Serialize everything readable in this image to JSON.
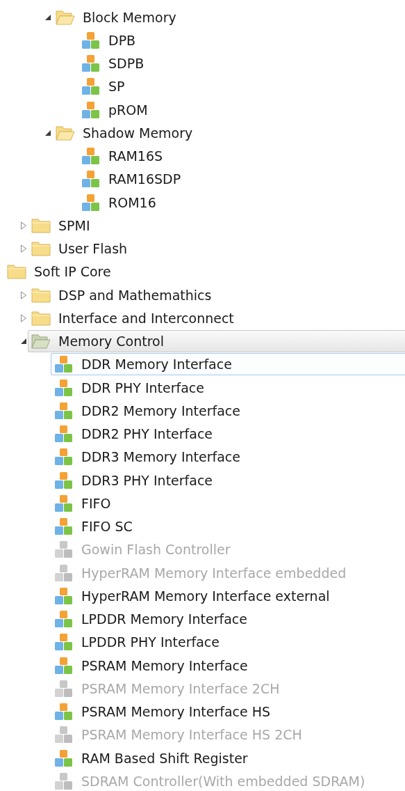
{
  "tree": [
    {
      "kind": "offscreen",
      "children": [
        {
          "kind": "offscreen",
          "children": [
            {
              "kind": "folder",
              "label": "Block Memory",
              "expanded": true,
              "selected": false,
              "children": [
                {
                  "kind": "ip",
                  "label": "DPB",
                  "disabled": false,
                  "selected": false
                },
                {
                  "kind": "ip",
                  "label": "SDPB",
                  "disabled": false,
                  "selected": false
                },
                {
                  "kind": "ip",
                  "label": "SP",
                  "disabled": false,
                  "selected": false
                },
                {
                  "kind": "ip",
                  "label": "pROM",
                  "disabled": false,
                  "selected": false
                }
              ]
            },
            {
              "kind": "folder",
              "label": "Shadow Memory",
              "expanded": true,
              "selected": false,
              "children": [
                {
                  "kind": "ip",
                  "label": "RAM16S",
                  "disabled": false,
                  "selected": false
                },
                {
                  "kind": "ip",
                  "label": "RAM16SDP",
                  "disabled": false,
                  "selected": false
                },
                {
                  "kind": "ip",
                  "label": "ROM16",
                  "disabled": false,
                  "selected": false
                }
              ]
            }
          ]
        },
        {
          "kind": "folder",
          "label": "SPMI",
          "expanded": false,
          "selected": false
        },
        {
          "kind": "folder",
          "label": "User Flash",
          "expanded": false,
          "selected": false
        }
      ]
    },
    {
      "kind": "root",
      "label": "Soft IP Core",
      "selected": false,
      "children": [
        {
          "kind": "folder",
          "label": "DSP and Mathemathics",
          "expanded": false,
          "selected": false
        },
        {
          "kind": "folder",
          "label": "Interface and Interconnect",
          "expanded": false,
          "selected": false
        },
        {
          "kind": "folder",
          "label": "Memory Control",
          "expanded": true,
          "selected": true,
          "children": [
            {
              "kind": "ip",
              "label": "DDR Memory Interface",
              "disabled": false,
              "selected": false,
              "focused": true
            },
            {
              "kind": "ip",
              "label": "DDR PHY Interface",
              "disabled": false,
              "selected": false
            },
            {
              "kind": "ip",
              "label": "DDR2 Memory Interface",
              "disabled": false,
              "selected": false
            },
            {
              "kind": "ip",
              "label": "DDR2 PHY Interface",
              "disabled": false,
              "selected": false
            },
            {
              "kind": "ip",
              "label": "DDR3 Memory Interface",
              "disabled": false,
              "selected": false
            },
            {
              "kind": "ip",
              "label": "DDR3 PHY Interface",
              "disabled": false,
              "selected": false
            },
            {
              "kind": "ip",
              "label": "FIFO",
              "disabled": false,
              "selected": false
            },
            {
              "kind": "ip",
              "label": "FIFO SC",
              "disabled": false,
              "selected": false
            },
            {
              "kind": "ip",
              "label": "Gowin Flash Controller",
              "disabled": true,
              "selected": false
            },
            {
              "kind": "ip",
              "label": "HyperRAM Memory Interface embedded",
              "disabled": true,
              "selected": false
            },
            {
              "kind": "ip",
              "label": "HyperRAM Memory Interface external",
              "disabled": false,
              "selected": false
            },
            {
              "kind": "ip",
              "label": "LPDDR Memory Interface",
              "disabled": false,
              "selected": false
            },
            {
              "kind": "ip",
              "label": "LPDDR PHY Interface",
              "disabled": false,
              "selected": false
            },
            {
              "kind": "ip",
              "label": "PSRAM Memory Interface",
              "disabled": false,
              "selected": false
            },
            {
              "kind": "ip",
              "label": "PSRAM Memory Interface 2CH",
              "disabled": true,
              "selected": false
            },
            {
              "kind": "ip",
              "label": "PSRAM Memory Interface HS",
              "disabled": false,
              "selected": false
            },
            {
              "kind": "ip",
              "label": "PSRAM Memory Interface HS 2CH",
              "disabled": true,
              "selected": false
            },
            {
              "kind": "ip",
              "label": "RAM Based Shift Register",
              "disabled": false,
              "selected": false
            },
            {
              "kind": "ip",
              "label": "SDRAM Controller(With embedded SDRAM)",
              "disabled": true,
              "selected": false
            }
          ]
        }
      ]
    }
  ]
}
